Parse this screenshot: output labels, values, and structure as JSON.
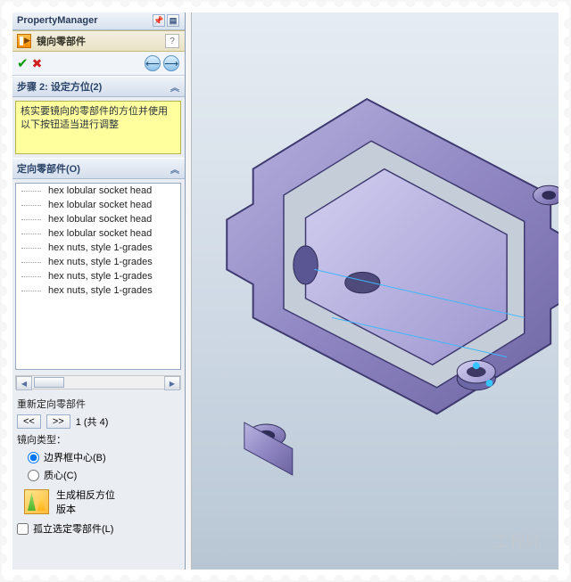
{
  "panel_title": "PropertyManager",
  "header": {
    "title": "镜向零部件",
    "help": "?"
  },
  "actions": {
    "ok": "✔",
    "cancel": "✖",
    "back": "⟵",
    "fwd": "⟶"
  },
  "step": {
    "title": "步骤 2: 设定方位(2)",
    "note": "核实要镜向的零部件的方位并使用以下按钮适当进行调整"
  },
  "orient": {
    "title": "定向零部件(O)",
    "items": [
      "hex lobular socket head",
      "hex lobular socket head",
      "hex lobular socket head",
      "hex lobular socket head",
      "hex nuts, style 1-grades",
      "hex nuts, style 1-grades",
      "hex nuts, style 1-grades",
      "hex nuts, style 1-grades"
    ]
  },
  "reorient": {
    "label": "重新定向零部件",
    "prev": "<<",
    "next": ">>",
    "count": "1 (共 4)"
  },
  "mirror_type": {
    "label": "镜向类型：",
    "opt_bbox": "边界框中心(B)",
    "opt_centroid": "质心(C)"
  },
  "generate": {
    "line1": "生成相反方位",
    "line2": "版本"
  },
  "isolate": {
    "label": "孤立选定零部件(L)"
  },
  "watermark": "工程师"
}
